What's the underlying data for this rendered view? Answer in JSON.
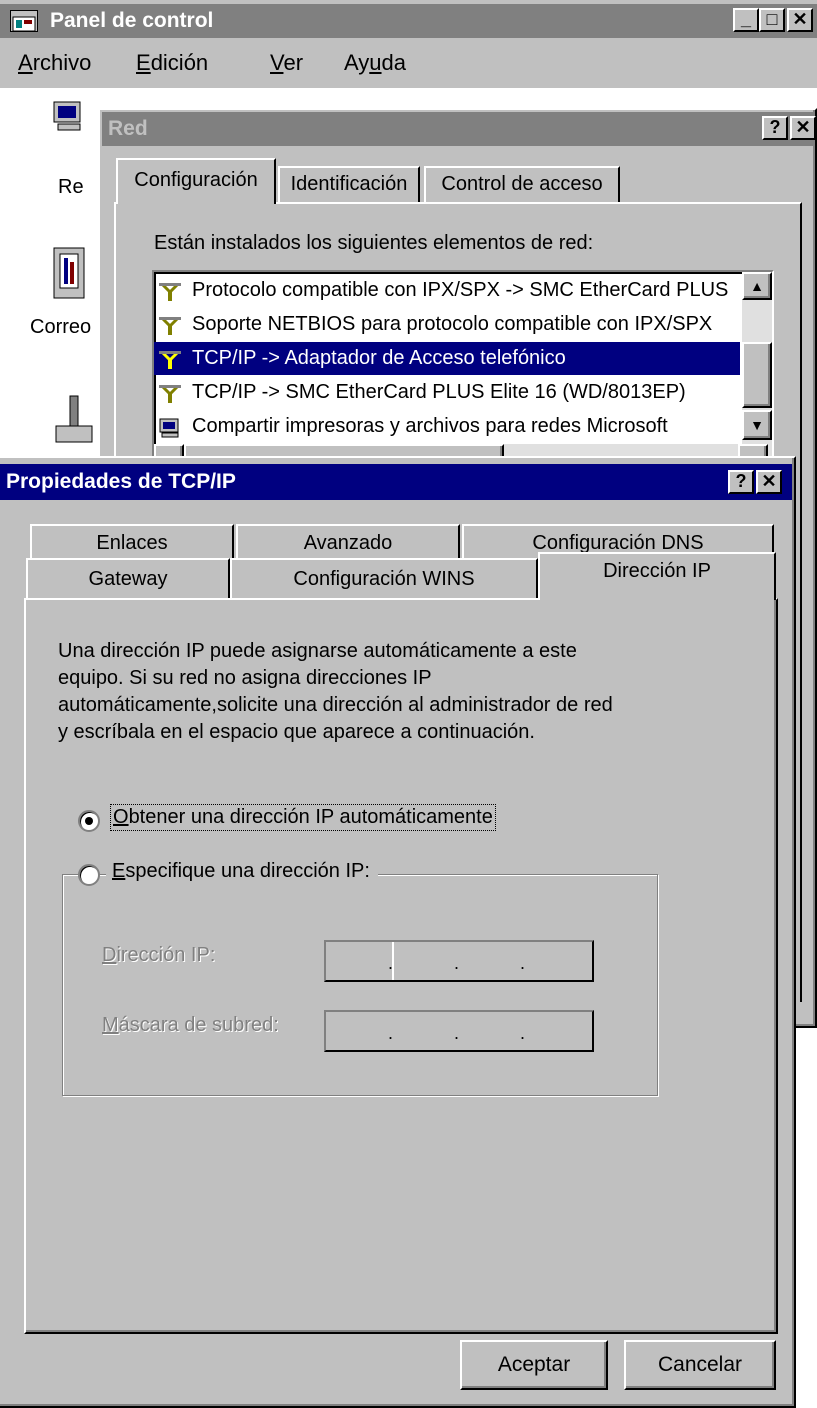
{
  "control_panel": {
    "title": "Panel de control",
    "menu": [
      "Archivo",
      "Edición",
      "Ver",
      "Ayuda"
    ],
    "icons": [
      "Re",
      "Correo"
    ],
    "title_color": "#808080"
  },
  "red_dialog": {
    "title": "Red",
    "help": "?",
    "close": "X",
    "tabs": [
      "Configuración",
      "Identificación",
      "Control de acceso"
    ],
    "list_label": "Están instalados los siguientes elementos de red:",
    "items": [
      "Protocolo compatible con IPX/SPX -> SMC EtherCard PLUS",
      "Soporte NETBIOS para protocolo compatible con IPX/SPX",
      "TCP/IP -> Adaptador de Acceso telefónico",
      "TCP/IP -> SMC EtherCard PLUS Elite 16 (WD/8013EP)",
      "Compartir impresoras y archivos para redes Microsoft"
    ],
    "selected_index": 2
  },
  "tcpip_dialog": {
    "title": "Propiedades de TCP/IP",
    "help": "?",
    "close": "X",
    "title_color": "#000080",
    "tabs_back": [
      "Enlaces",
      "Avanzado",
      "Configuración DNS"
    ],
    "tabs_front": [
      "Gateway",
      "Configuración WINS",
      "Dirección IP"
    ],
    "active_tab": "Dirección IP",
    "description": "Una dirección IP puede asignarse automáticamente a este equipo. Si su red no asigna direcciones IP automáticamente,solicite una dirección al administrador de red y escríbala en el espacio que aparece a continuación.",
    "radio_auto": "Obtener una dirección IP automáticamente",
    "radio_specify": "Especifique una dirección IP:",
    "auto_selected": true,
    "ip_label": "Dirección IP:",
    "mask_label": "Máscara de subred:",
    "ok": "Aceptar",
    "cancel": "Cancelar"
  }
}
